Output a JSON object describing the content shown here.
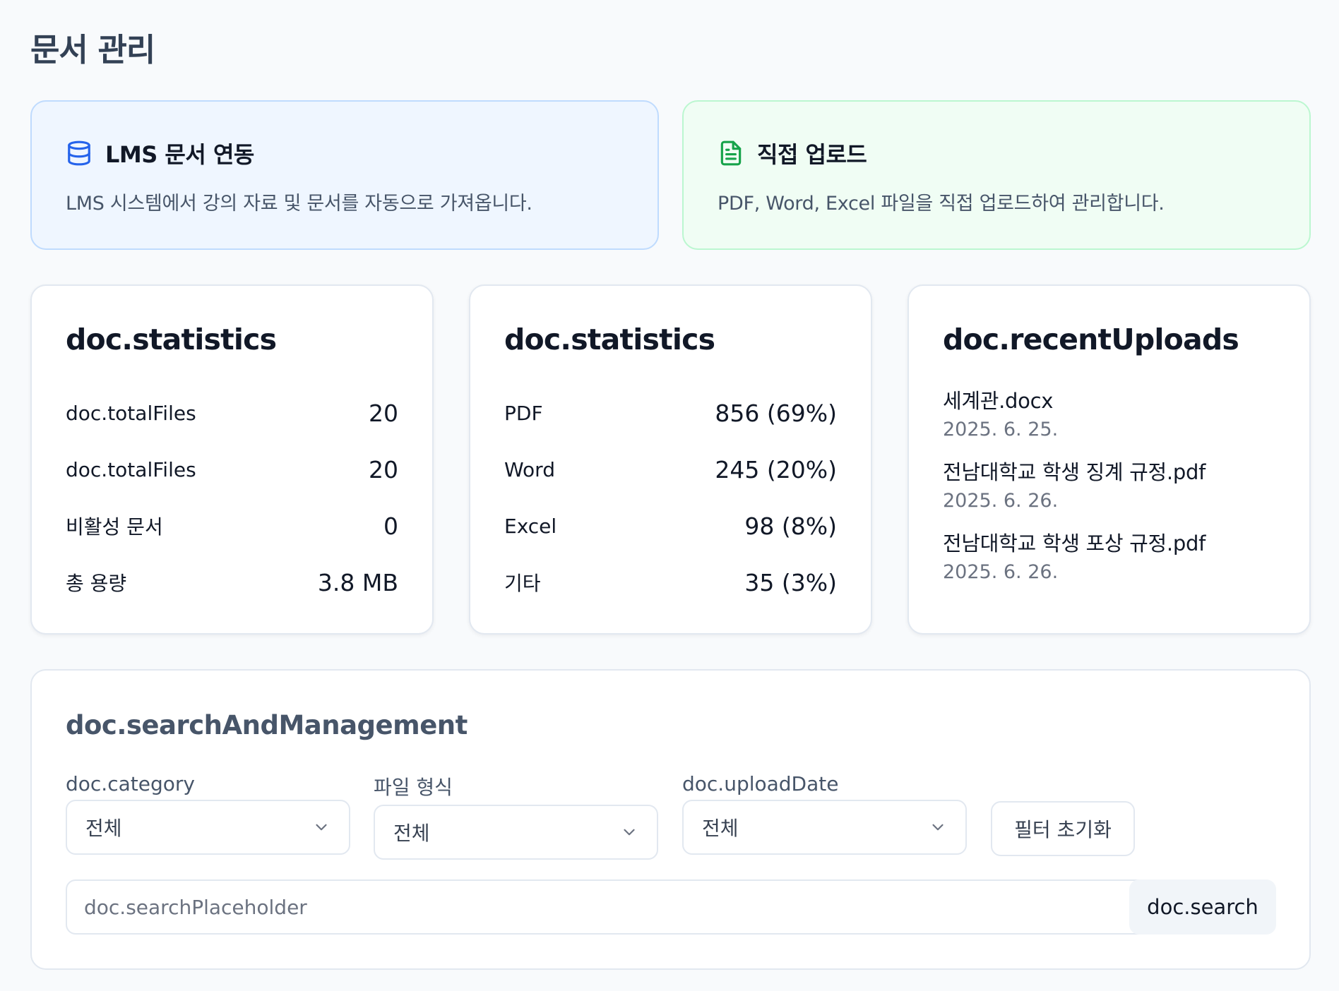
{
  "page": {
    "title": "문서 관리"
  },
  "sources": {
    "lms": {
      "icon": "database-icon",
      "title": "LMS 문서 연동",
      "description": "LMS 시스템에서 강의 자료 및 문서를 자동으로 가져옵니다.",
      "accent": "#2563eb"
    },
    "upload": {
      "icon": "file-text-icon",
      "title": "직접 업로드",
      "description": "PDF, Word, Excel 파일을 직접 업로드하여 관리합니다.",
      "accent": "#16a34a"
    }
  },
  "stats_general": {
    "title": "doc.statistics",
    "rows": [
      {
        "label": "doc.totalFiles",
        "value": "20"
      },
      {
        "label": "doc.totalFiles",
        "value": "20"
      },
      {
        "label": "비활성 문서",
        "value": "0"
      },
      {
        "label": "총 용량",
        "value": "3.8 MB"
      }
    ]
  },
  "stats_types": {
    "title": "doc.statistics",
    "rows": [
      {
        "label": "PDF",
        "value": "856 (69%)"
      },
      {
        "label": "Word",
        "value": "245 (20%)"
      },
      {
        "label": "Excel",
        "value": "98 (8%)"
      },
      {
        "label": "기타",
        "value": "35 (3%)"
      }
    ]
  },
  "recent_uploads": {
    "title": "doc.recentUploads",
    "items": [
      {
        "name": "세계관.docx",
        "date": "2025. 6. 25."
      },
      {
        "name": "전남대학교 학생 징계 규정.pdf",
        "date": "2025. 6. 26."
      },
      {
        "name": "전남대학교 학생 포상 규정.pdf",
        "date": "2025. 6. 26."
      }
    ]
  },
  "search": {
    "title": "doc.searchAndManagement",
    "filters": [
      {
        "label": "doc.category",
        "selected": "전체"
      },
      {
        "label": "파일 형식",
        "selected": "전체"
      },
      {
        "label": "doc.uploadDate",
        "selected": "전체"
      }
    ],
    "reset_label": "필터 초기화",
    "placeholder": "doc.searchPlaceholder",
    "search_label": "doc.search"
  }
}
